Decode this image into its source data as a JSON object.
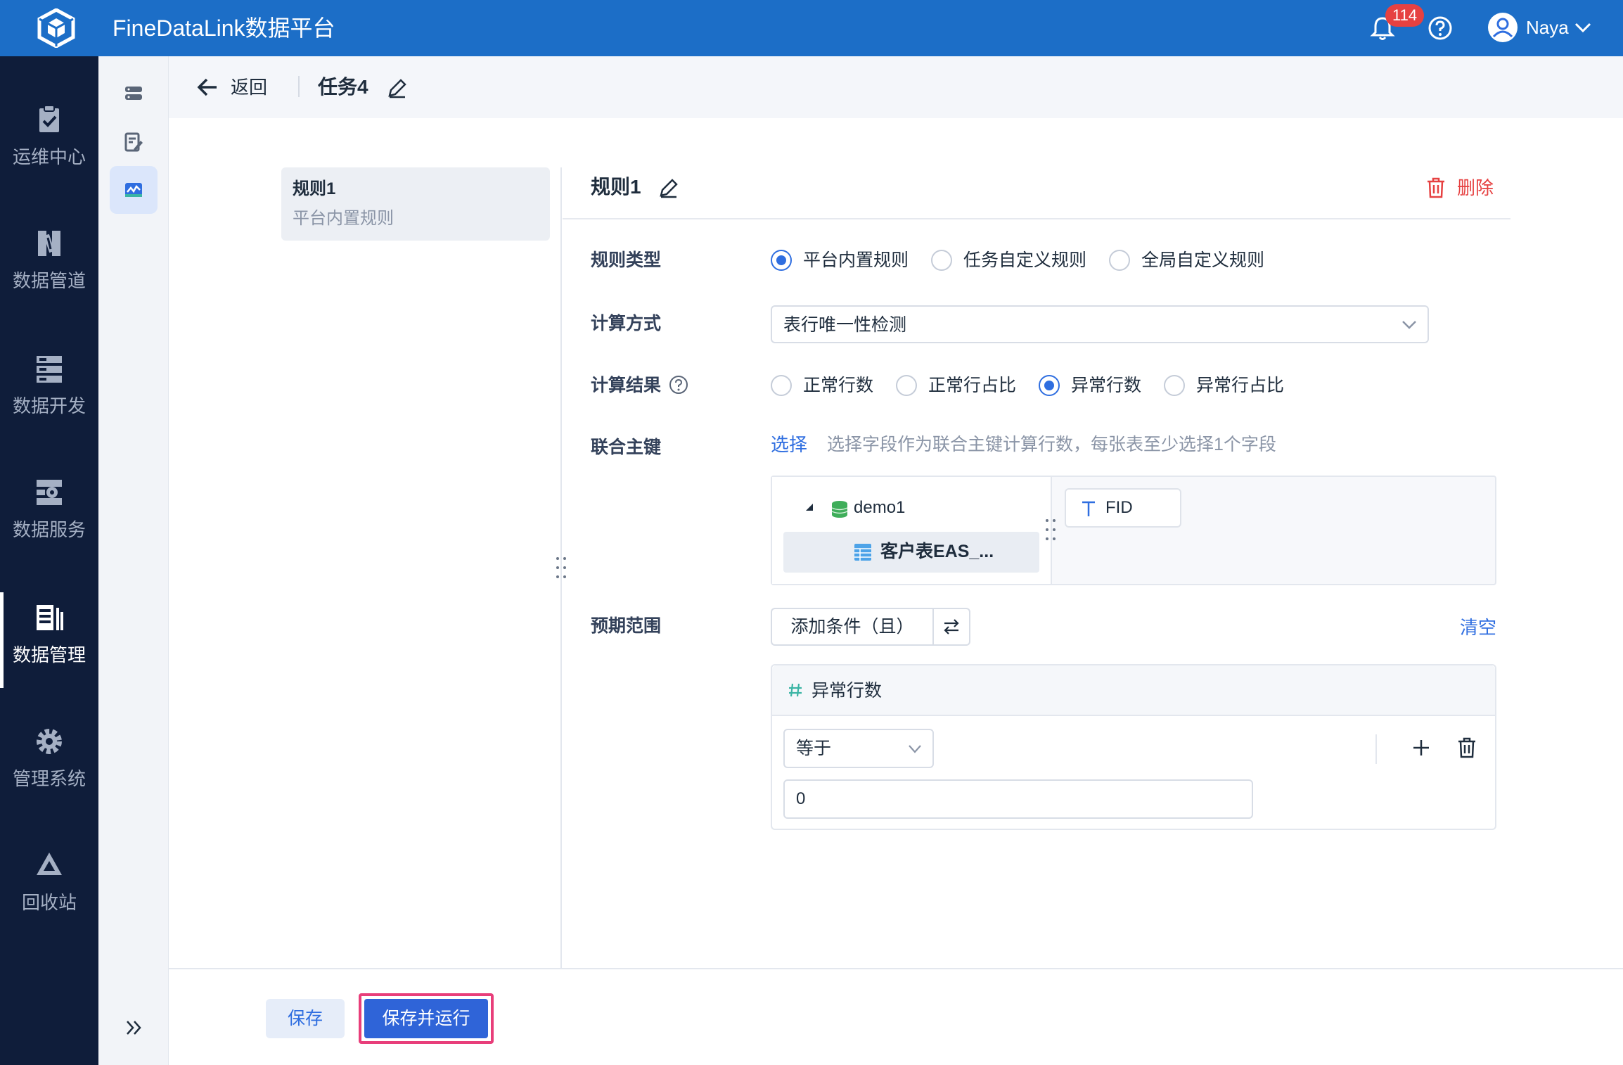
{
  "header": {
    "app_title": "FineDataLink数据平台",
    "notification_count": "114",
    "user_name": "Naya"
  },
  "sidebar": {
    "items": [
      {
        "label": "运维中心",
        "icon": "clipboard-check-icon",
        "active": false
      },
      {
        "label": "数据管道",
        "icon": "pipeline-icon",
        "active": false
      },
      {
        "label": "数据开发",
        "icon": "server-stack-icon",
        "active": false
      },
      {
        "label": "数据服务",
        "icon": "api-service-icon",
        "active": false
      },
      {
        "label": "数据管理",
        "icon": "data-manage-icon",
        "active": true
      },
      {
        "label": "管理系统",
        "icon": "gear-icon",
        "active": false
      },
      {
        "label": "回收站",
        "icon": "recycle-icon",
        "active": false
      }
    ]
  },
  "breadcrumb": {
    "back_label": "返回",
    "task_title": "任务4"
  },
  "rule_list": [
    {
      "name": "规则1",
      "type": "平台内置规则"
    }
  ],
  "rule_detail": {
    "title": "规则1",
    "delete_label": "删除",
    "rule_type": {
      "label": "规则类型",
      "options": [
        "平台内置规则",
        "任务自定义规则",
        "全局自定义规则"
      ],
      "selected": "平台内置规则"
    },
    "calc_method": {
      "label": "计算方式",
      "value": "表行唯一性检测"
    },
    "calc_result": {
      "label": "计算结果",
      "options": [
        "正常行数",
        "正常行占比",
        "异常行数",
        "异常行占比"
      ],
      "selected": "异常行数"
    },
    "primary_key": {
      "label": "联合主键",
      "pick_label": "选择",
      "hint": "选择字段作为联合主键计算行数，每张表至少选择1个字段",
      "database": "demo1",
      "table": "客户表EAS_...",
      "fields": [
        "FID"
      ]
    },
    "expected_range": {
      "label": "预期范围",
      "add_condition_label": "添加条件（且）",
      "clear_label": "清空",
      "condition": {
        "field": "异常行数",
        "operator": "等于",
        "value": "0"
      }
    }
  },
  "footer": {
    "save_label": "保存",
    "save_run_label": "保存并运行"
  },
  "colors": {
    "header_bg": "#1c6ec7",
    "sidebar_bg": "#0f1d3a",
    "primary": "#2f6ee0",
    "danger": "#e64141",
    "highlight_border": "#e83e7a"
  }
}
